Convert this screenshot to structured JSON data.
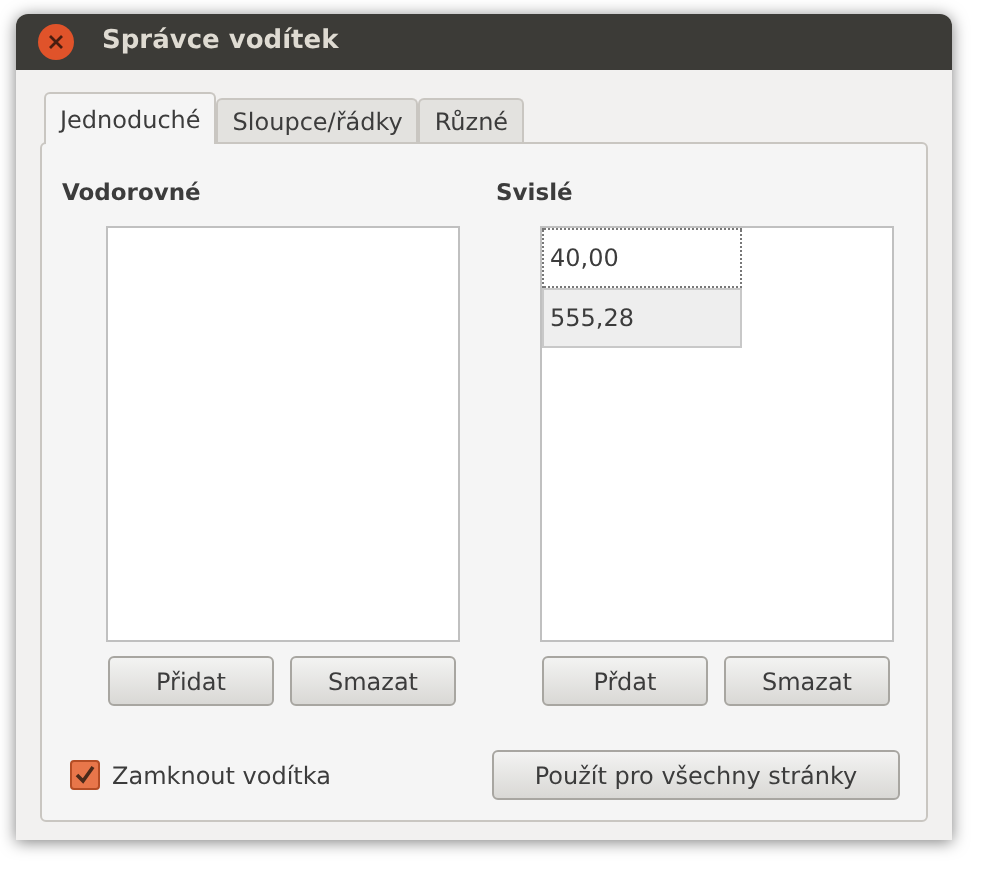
{
  "window": {
    "title": "Správce vodítek"
  },
  "tabs": [
    {
      "label": "Jednoduché",
      "selected": true
    },
    {
      "label": "Sloupce/řádky",
      "selected": false
    },
    {
      "label": "Různé",
      "selected": false
    }
  ],
  "columns": [
    {
      "heading": "Vodorovné",
      "buttons": [
        "Přidat",
        "Smazat"
      ]
    },
    {
      "heading": "Svislé",
      "items": [
        {
          "value": "40,00",
          "selected": false,
          "focused": true
        },
        {
          "value": "555,28",
          "selected": true,
          "focused": false
        }
      ],
      "buttons": [
        "Přdat",
        "Smazat"
      ]
    }
  ],
  "lock_checkbox": {
    "label": "Zamknout vodítka",
    "checked": true
  },
  "apply_button": "Použít pro všechny stránky"
}
